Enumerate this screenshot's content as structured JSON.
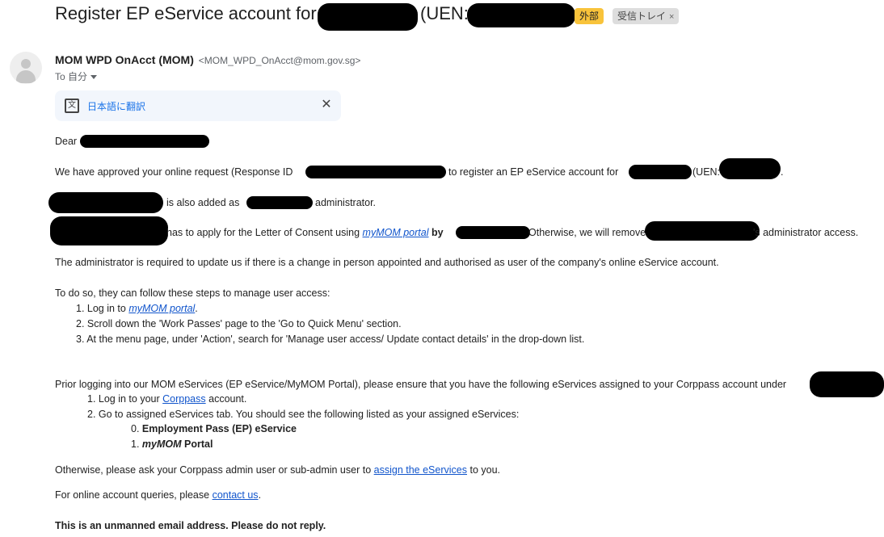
{
  "email": {
    "subject_prefix": "Register EP eService account for",
    "subject_uen": "(UEN:",
    "labels": {
      "external": "外部",
      "inbox": "受信トレイ",
      "inbox_close": "×"
    },
    "sender_name": "MOM WPD OnAcct (MOM)",
    "sender_email": "<MOM_WPD_OnAcct@mom.gov.sg>",
    "recipient": "To 自分",
    "translate_label": "日本語に翻訳",
    "translate_close": "✕"
  },
  "body": {
    "greeting": "Dear",
    "approved": {
      "part1": "We have approved your online request (Response ID",
      "part2": "to register an EP eService account for",
      "part3": "(UEN:",
      "part4": "."
    },
    "added": {
      "part1": "is also added as",
      "part2": "administrator."
    },
    "apply": {
      "part1": "has to apply for the Letter of Consent using",
      "link": "myMOM portal",
      "part2": "by",
      "part3": "Otherwise, we will remove",
      "part4": "'s administrator access."
    },
    "required": "The administrator is required to update us if there is a change in person appointed and authorised as user of the company's online eService account.",
    "todo_intro": "To do so, they can follow these steps to manage user access:",
    "steps": {
      "s1_prefix": "1. Log in to",
      "s1_link": "myMOM portal",
      "s1_suffix": ".",
      "s2": "2. Scroll down the 'Work Passes' page to the 'Go to Quick Menu' section.",
      "s3": "3. At the menu page, under 'Action', search for 'Manage user access/ Update contact details' in the drop-down list."
    },
    "prior": "Prior logging into our MOM eServices (EP eService/MyMOM Portal), please ensure that you have the following eServices assigned to your Corppass account under",
    "cp_steps": {
      "s1_prefix": "1. Log in to your",
      "s1_link": "Corppass",
      "s1_suffix": "account.",
      "s2": "2. Go to assigned eServices tab. You should see the following listed as your assigned eServices:",
      "e0_num": "0.",
      "e0": "Employment Pass (EP) eService",
      "e1_num": "1.",
      "e1_italic": "myMOM",
      "e1_rest": "Portal"
    },
    "otherwise": {
      "prefix": "Otherwise, please ask your Corppass admin user or sub-admin user to",
      "link": "assign the eServices",
      "suffix": "to you."
    },
    "queries": {
      "prefix": "For online account queries, please",
      "link": "contact us",
      "suffix": "."
    },
    "unmanned": "This is an unmanned email address. Please do not reply."
  }
}
